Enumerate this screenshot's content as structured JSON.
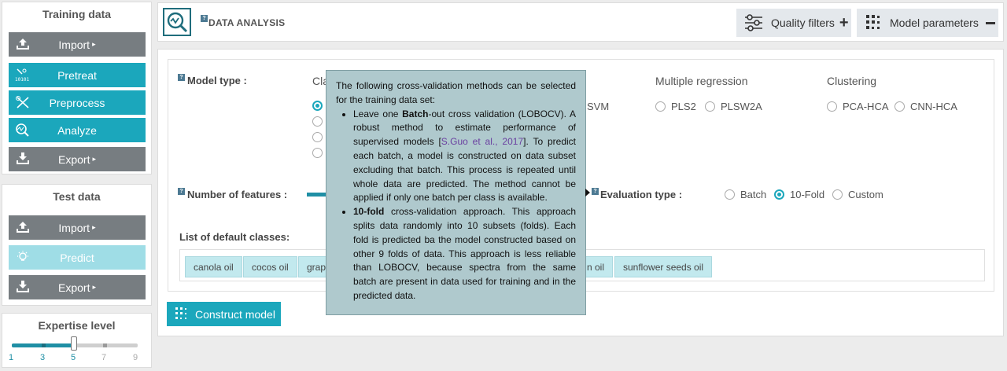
{
  "sidebar": {
    "training": {
      "title": "Training data",
      "buttons": [
        "Import",
        "Pretreat",
        "Preprocess",
        "Analyze",
        "Export"
      ]
    },
    "test": {
      "title": "Test data",
      "buttons": [
        "Import",
        "Predict",
        "Export"
      ]
    },
    "expertise": {
      "title": "Expertise level",
      "levels": [
        "1",
        "3",
        "5",
        "7",
        "9"
      ],
      "value": 5
    }
  },
  "header": {
    "help": "?",
    "title": "DATA ANALYSIS",
    "quality_filters": "Quality filters",
    "model_parameters": "Model parameters"
  },
  "model": {
    "label": "Model type :",
    "classification_group_partial": "Cla",
    "svm_partial": "SVM",
    "multiple_regression": {
      "title": "Multiple regression",
      "options": [
        "PLS2",
        "PLSW2A"
      ]
    },
    "clustering": {
      "title": "Clustering",
      "options": [
        "PCA-HCA",
        "CNN-HCA"
      ]
    }
  },
  "features": {
    "label": "Number of features :"
  },
  "evaluation": {
    "label": "Evaluation type :",
    "options": [
      "Batch",
      "10-Fold",
      "Custom"
    ],
    "selected": "10-Fold"
  },
  "classes": {
    "label": "List of default classes:",
    "chips": [
      "canola oil",
      "cocos oil",
      "grape",
      "n oil",
      "sunflower seeds oil"
    ]
  },
  "construct_button": "Construct model",
  "tooltip": {
    "intro": "The following cross-validation methods can be selected for the training data set:",
    "item1": {
      "pre": "Leave one ",
      "bold": "Batch",
      "mid": "-out cross validation (LOBOCV). A robust method to estimate performance of supervised models [",
      "ref": "S.Guo et al., 2017",
      "post": "]. To predict each batch, a model is constructed on data subset excluding that batch. This process is repeated until whole data are predicted. The method cannot be applied if only one batch per class is available."
    },
    "item2": {
      "bold": "10-fold",
      "post": " cross-validation approach. This approach splits data randomly into 10 subsets (folds). Each fold is predicted ba the model constructed based on other 9 folds of data. This approach is less reliable than LOBOCV, because spectra from the same batch are present in data used for training and in the predicted data."
    }
  },
  "colors": {
    "teal": "#1ba7bc",
    "gray_button": "#777d81",
    "tooltip_bg": "#afc9cd",
    "link": "#6a3fa0"
  }
}
